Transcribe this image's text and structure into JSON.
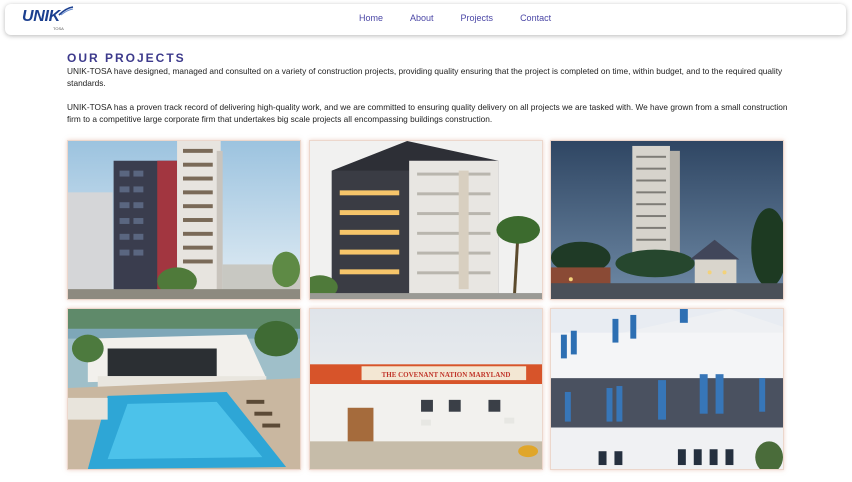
{
  "brand": {
    "name": "UNIK",
    "sub": "TOSA"
  },
  "nav": {
    "items": [
      {
        "label": "Home"
      },
      {
        "label": "About"
      },
      {
        "label": "Projects"
      },
      {
        "label": "Contact"
      }
    ]
  },
  "projects_section": {
    "title": "OUR PROJECTS",
    "paragraph_1": "UNIK-TOSA have designed, managed and consulted on a variety of construction projects, providing quality ensuring that the project is completed on time, within budget, and to the required quality standards.",
    "paragraph_2": "UNIK-TOSA has a proven track record of delivering high-quality work, and we are committed to ensuring quality delivery on all projects we are tasked with. We have grown from a small construction firm to a competitive large corporate firm that undertakes big scale projects all encompassing buildings construction."
  },
  "gallery": {
    "sign_text": "THE COVENANT NATION MARYLAND"
  },
  "colors": {
    "accent": "#3d3a8c",
    "nav_link": "#4b47a6",
    "brand_blue": "#1b3f8f"
  }
}
